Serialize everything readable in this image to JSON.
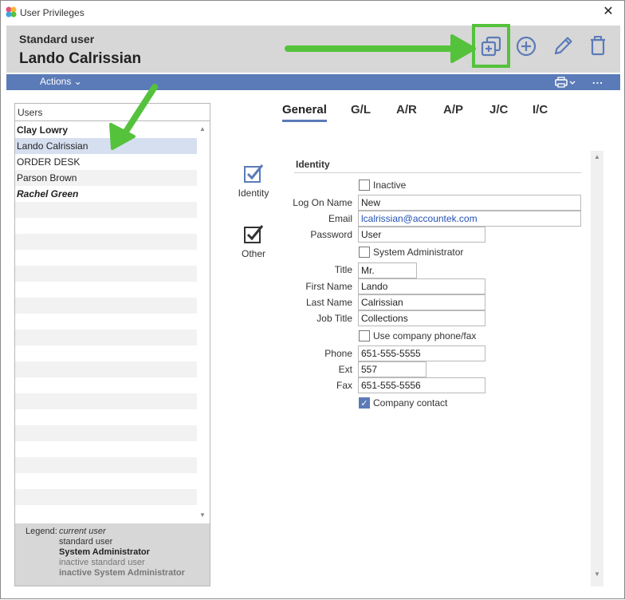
{
  "window": {
    "title": "User Privileges",
    "close_glyph": "✕"
  },
  "header": {
    "role": "Standard user",
    "user_name": "Lando Calrissian",
    "icons": [
      "copy-add-icon",
      "add-circle-icon",
      "pencil-icon",
      "trash-icon"
    ]
  },
  "actionbar": {
    "actions_label": "Actions ⌄",
    "more_label": "..."
  },
  "users": {
    "header": "Users",
    "rows": [
      {
        "name": "Clay Lowry",
        "kind": "current"
      },
      {
        "name": "Lando Calrissian",
        "kind": "selected"
      },
      {
        "name": "ORDER DESK",
        "kind": "standard"
      },
      {
        "name": "Parson Brown",
        "kind": "standard"
      },
      {
        "name": "Rachel Green",
        "kind": "admin"
      }
    ]
  },
  "legend": {
    "label": "Legend:",
    "current": "current user",
    "standard": "standard user",
    "admin": "System Administrator",
    "inactive_standard": "inactive standard user",
    "inactive_admin": "inactive System Administrator"
  },
  "tabs": [
    "General",
    "G/L",
    "A/R",
    "A/P",
    "J/C",
    "I/C"
  ],
  "sidenav": {
    "identity": "Identity",
    "other": "Other"
  },
  "form": {
    "section": "Identity",
    "inactive_label": "Inactive",
    "logon_label": "Log On Name",
    "logon_value": "New",
    "email_label": "Email",
    "email_value": "lcalrissian@accountek.com",
    "password_label": "Password",
    "password_value": "User",
    "sysadmin_label": "System Administrator",
    "title_label": "Title",
    "title_value": "Mr.",
    "first_label": "First Name",
    "first_value": "Lando",
    "last_label": "Last Name",
    "last_value": "Calrissian",
    "job_label": "Job Title",
    "job_value": "Collections",
    "use_company_label": "Use company phone/fax",
    "phone_label": "Phone",
    "phone_value": "651-555-5555",
    "ext_label": "Ext",
    "ext_value": "557",
    "fax_label": "Fax",
    "fax_value": "651-555-5556",
    "company_contact_label": "Company contact",
    "checks": {
      "inactive": false,
      "sysadmin": false,
      "use_company": false,
      "company_contact": true
    }
  },
  "colors": {
    "accent": "#5b7bb8",
    "highlight_arrow": "#55c23b",
    "header_bg": "#d7d7d7"
  }
}
